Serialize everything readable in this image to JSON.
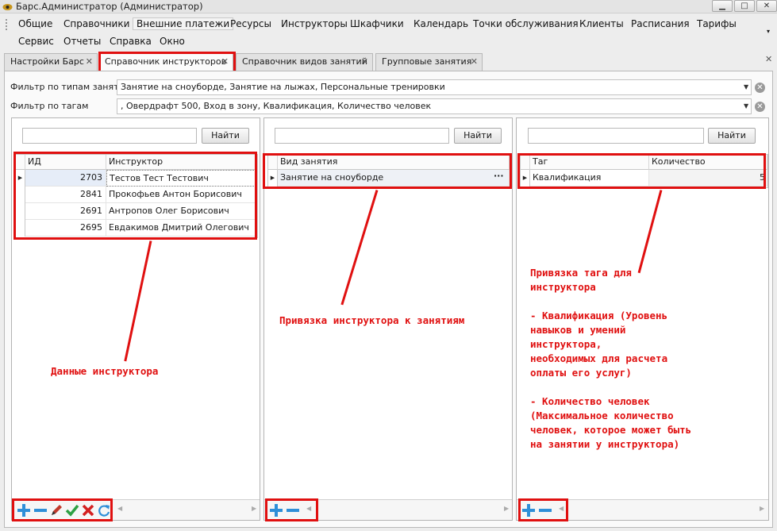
{
  "window": {
    "title": "Барс.Администратор (Администратор)",
    "min": "▁",
    "max": "□",
    "close": "✕"
  },
  "menu": {
    "row1": [
      "Общие",
      "Справочники",
      "Внешние платежи",
      "Ресурсы",
      "Инструкторы",
      "Шкафчики",
      "Календарь",
      "Точки обслуживания",
      "Клиенты",
      "Расписания",
      "Тарифы"
    ],
    "row2": [
      "Сервис",
      "Отчеты",
      "Справка",
      "Окно"
    ]
  },
  "tabs": [
    "Настройки Барс",
    "Справочник инструкторов",
    "Справочник видов занятий",
    "Групповые занятия"
  ],
  "filters": {
    "type_label": "Фильтр по типам занятий",
    "type_value": "Занятие на сноуборде, Занятие на лыжах, Персональные тренировки",
    "tag_label": "Фильтр по тагам",
    "tag_value": ", Овердрафт 500, Вход в зону, Квалификация, Количество человек"
  },
  "search": {
    "button": "Найти"
  },
  "instructors": {
    "columns": [
      "ИД",
      "Инструктор"
    ],
    "rows": [
      {
        "id": "2703",
        "name": "Тестов Тест Тестович"
      },
      {
        "id": "2841",
        "name": "Прокофьев Антон Борисович"
      },
      {
        "id": "2691",
        "name": "Антропов Олег Борисович"
      },
      {
        "id": "2695",
        "name": "Евдакимов Дмитрий Олегович"
      }
    ]
  },
  "lessons": {
    "columns": [
      "Вид занятия"
    ],
    "rows": [
      {
        "name": "Занятие на сноуборде",
        "more": "···"
      }
    ]
  },
  "tags": {
    "columns": [
      "Таг",
      "Количество"
    ],
    "rows": [
      {
        "tag": "Квалификация",
        "count": "5"
      }
    ]
  },
  "notes": {
    "instructor": "Данные инструктора",
    "binding": "Привязка инструктора к занятиям",
    "tag": "Привязка тага для\nинструктора\n\n- Квалификация (Уровень\nнавыков и умений\nинструктора,\nнеобходимых для расчета\nоплаты его услуг)\n\n- Количество человек\n(Максимальное количество\nчеловек, которое может быть\nна занятии у инструктора)"
  },
  "colors": {
    "annotation": "#e01010",
    "add": "#2f8fd8",
    "remove": "#2f8fd8",
    "edit": "#c0392b",
    "save": "#2ea043",
    "cancel": "#d42020",
    "refresh": "#2f8fd8"
  },
  "icons": {
    "add": "plus-icon",
    "remove": "minus-icon",
    "edit": "pencil-icon",
    "save": "check-icon",
    "cancel": "x-icon",
    "refresh": "refresh-icon"
  }
}
